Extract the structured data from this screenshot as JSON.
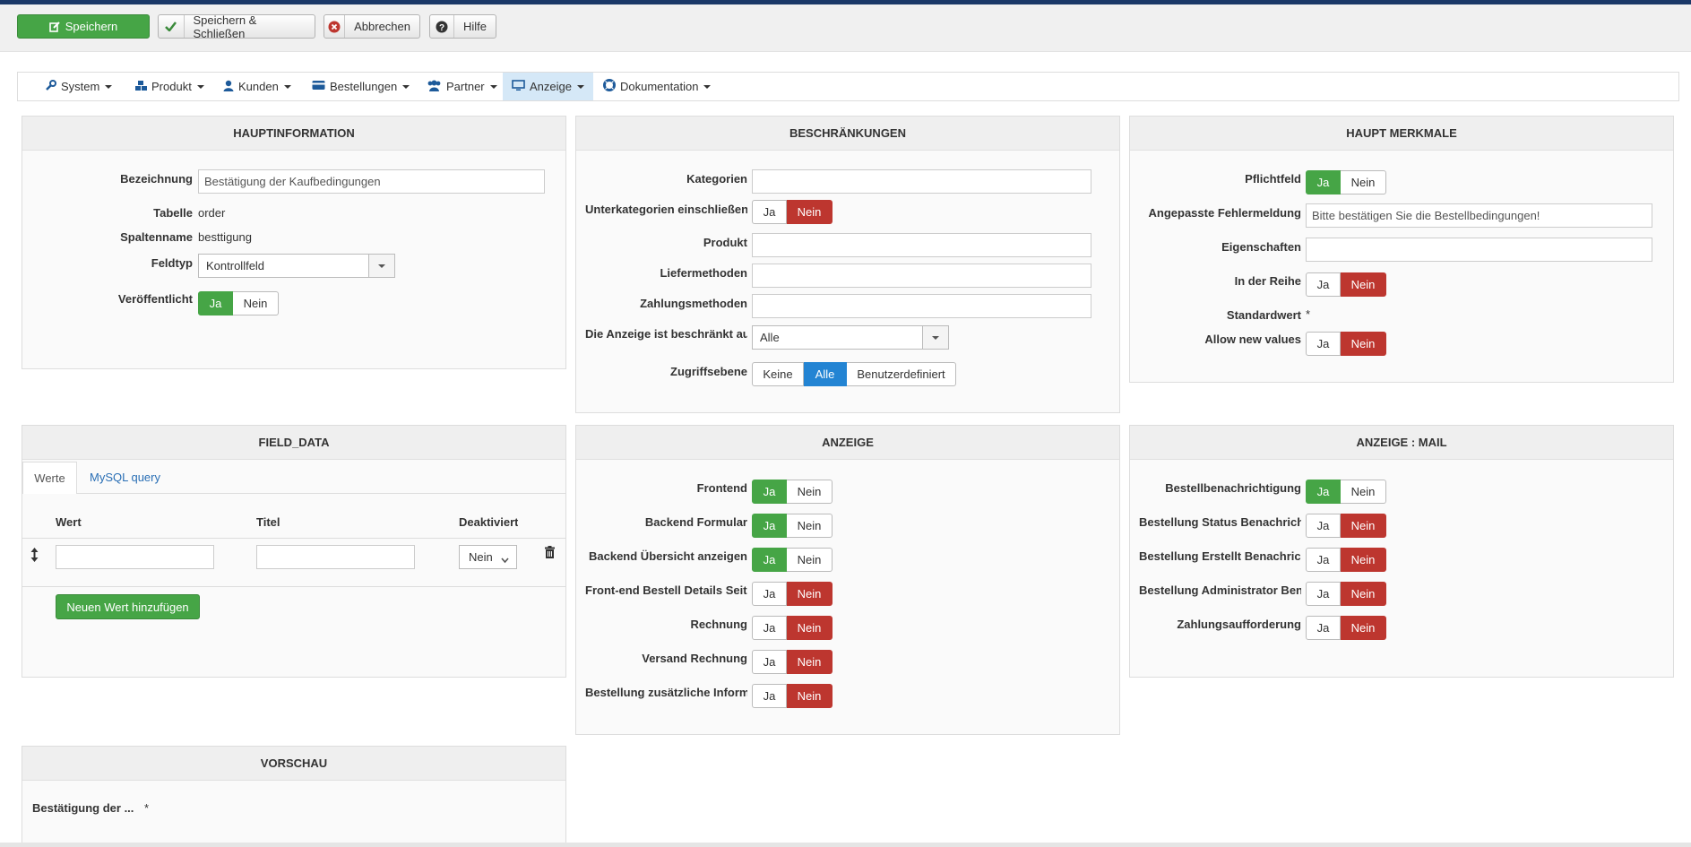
{
  "toolbar": {
    "save": "Speichern",
    "save_close": "Speichern & Schließen",
    "cancel": "Abbrechen",
    "help": "Hilfe"
  },
  "nav": {
    "items": [
      "System",
      "Produkt",
      "Kunden",
      "Bestellungen",
      "Partner",
      "Anzeige",
      "Dokumentation"
    ],
    "active": "Anzeige"
  },
  "toggle": {
    "yes": "Ja",
    "no": "Nein"
  },
  "haupt": {
    "title": "HAUPTINFORMATION",
    "bezeichnung_label": "Bezeichnung",
    "bezeichnung_value": "Bestätigung der Kaufbedingungen",
    "tabelle_label": "Tabelle",
    "tabelle_value": "order",
    "spalte_label": "Spaltenname",
    "spalte_value": "besttigung",
    "feldtyp_label": "Feldtyp",
    "feldtyp_value": "Kontrollfeld",
    "veroeff_label": "Veröffentlicht",
    "veroeff_state": "Ja"
  },
  "beschr": {
    "title": "BESCHRÄNKUNGEN",
    "kategorien": "Kategorien",
    "unterkat": "Unterkategorien einschließen",
    "unterkat_state": "Nein",
    "produkt": "Produkt",
    "lieferm": "Liefermethoden",
    "zahlm": "Zahlungsmethoden",
    "anzeige_label": "Die Anzeige ist beschränkt auf",
    "anzeige_value": "Alle",
    "zugriff_label": "Zugriffsebene",
    "zugriff_options": [
      "Keine",
      "Alle",
      "Benutzerdefiniert"
    ],
    "zugriff_state": "Alle"
  },
  "merkmale": {
    "title": "HAUPT MERKMALE",
    "pflicht": "Pflichtfeld",
    "pflicht_state": "Ja",
    "fehler_label": "Angepasste Fehlermeldung",
    "fehler_value": "Bitte bestätigen Sie die Bestellbedingungen!",
    "eigen": "Eigenschaften",
    "reihe": "In der Reihe",
    "reihe_state": "Nein",
    "standard": "Standardwert",
    "standard_value": "*",
    "allow": "Allow new values",
    "allow_state": "Nein"
  },
  "fielddata": {
    "title": "FIELD_DATA",
    "tab_werte": "Werte",
    "tab_mysql": "MySQL query",
    "col_wert": "Wert",
    "col_titel": "Titel",
    "col_deakt": "Deaktiviert",
    "deakt_value": "Nein",
    "add_button": "Neuen Wert hinzufügen"
  },
  "anzeige": {
    "title": "ANZEIGE",
    "rows": [
      {
        "label": "Frontend",
        "state": "Ja"
      },
      {
        "label": "Backend Formular",
        "state": "Ja"
      },
      {
        "label": "Backend Übersicht anzeigen",
        "state": "Ja"
      },
      {
        "label": "Front-end Bestell Details Seite",
        "state": "Nein"
      },
      {
        "label": "Rechnung",
        "state": "Nein"
      },
      {
        "label": "Versand Rechnung",
        "state": "Nein"
      },
      {
        "label": "Bestellung zusätzliche Informationen",
        "state": "Nein"
      }
    ]
  },
  "mail": {
    "title": "ANZEIGE : MAIL",
    "rows": [
      {
        "label": "Bestellbenachrichtigung",
        "state": "Ja"
      },
      {
        "label": "Bestellung Status Benachrichtigung",
        "state": "Nein"
      },
      {
        "label": "Bestellung Erstellt Benachrichtigung",
        "state": "Nein"
      },
      {
        "label": "Bestellung Administrator Benachrichtigung",
        "state": "Nein"
      },
      {
        "label": "Zahlungsaufforderung",
        "state": "Nein"
      }
    ]
  },
  "vorschau": {
    "title": "VORSCHAU",
    "label": "Bestätigung der ...",
    "star": "*"
  },
  "colors": {
    "green": "#46a546",
    "red": "#bd362f",
    "blue": "#2384d3",
    "nav_active": "#d5e8f7",
    "topbar": "#1a3867"
  }
}
